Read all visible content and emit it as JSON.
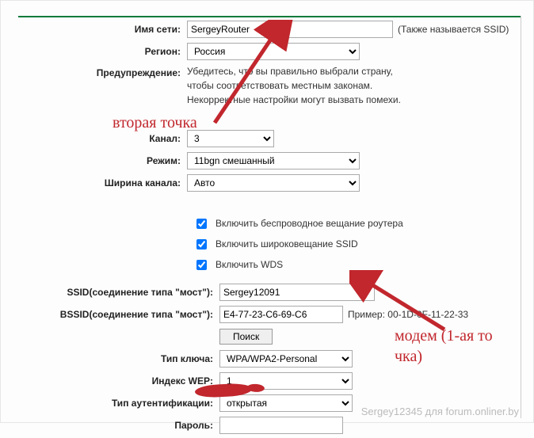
{
  "labels": {
    "ssid_name": "Имя сети:",
    "region": "Регион:",
    "warning": "Предупреждение:",
    "channel": "Канал:",
    "mode": "Режим:",
    "channel_width": "Ширина канала:",
    "wds_ssid": "SSID(соединение типа \"мост\"):",
    "wds_bssid": "BSSID(соединение типа \"мост\"):",
    "key_type": "Тип ключа:",
    "wep_index": "Индекс WEP:",
    "auth_type": "Тип аутентификации:",
    "password": "Пароль:"
  },
  "values": {
    "ssid_name": "SergeyRouter",
    "region": "Россия",
    "channel": "3",
    "mode": "11bgn смешанный",
    "channel_width": "Авто",
    "wds_ssid": "Sergey12091",
    "wds_bssid": "E4-77-23-C6-69-C6",
    "key_type": "WPA/WPA2-Personal",
    "wep_index": "1",
    "auth_type": "открытая",
    "password": ""
  },
  "hints": {
    "ssid_aka": "(Также называется SSID)",
    "warning_text": "Убедитесь, что вы правильно выбрали страну,\nчтобы соответствовать местным законам.\nНекорректные настройки могут вызвать помехи.",
    "bssid_example": "Пример: 00-1D-0F-11-22-33"
  },
  "checkboxes": {
    "enable_wireless": "Включить беспроводное вещание роутера",
    "enable_ssid_broadcast": "Включить широковещание SSID",
    "enable_wds": "Включить WDS"
  },
  "buttons": {
    "search": "Поиск"
  },
  "annotations": {
    "second_point": "вторая точка",
    "modem": "модем (1-ая то\nчка)"
  },
  "watermark": "Sergey12345 для forum.onliner.by"
}
